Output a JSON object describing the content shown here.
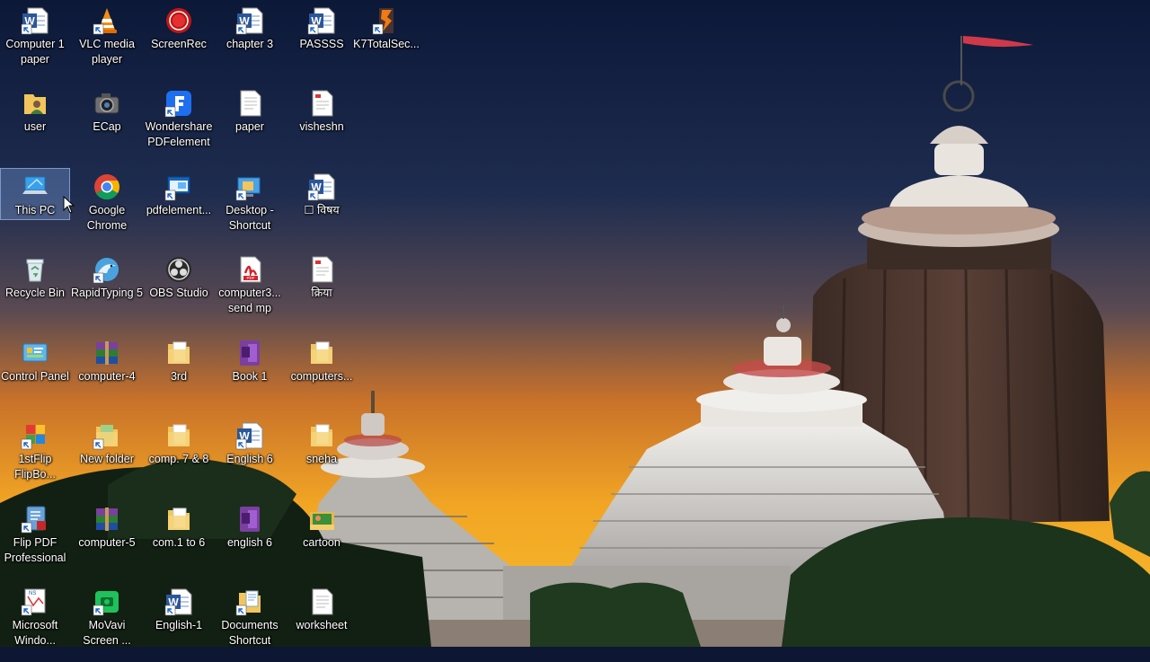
{
  "desktop": {
    "columns": [
      [
        {
          "label": "Computer 1 paper",
          "icon": "word-document-icon",
          "kind": "word"
        },
        {
          "label": "user",
          "icon": "user-folder-icon",
          "kind": "userfolder"
        },
        {
          "label": "This PC",
          "icon": "computer-icon",
          "kind": "pc",
          "selected": true
        },
        {
          "label": "Recycle Bin",
          "icon": "recycle-bin-icon",
          "kind": "bin"
        },
        {
          "label": "Control Panel",
          "icon": "control-panel-icon",
          "kind": "cpanel"
        },
        {
          "label": "1stFlip FlipBo...",
          "icon": "flipbook-icon",
          "kind": "flip"
        },
        {
          "label": "Flip PDF Professional",
          "icon": "flip-pdf-icon",
          "kind": "flippdf"
        },
        {
          "label": "Microsoft Windo...",
          "icon": "ms-app-icon",
          "kind": "msapp"
        }
      ],
      [
        {
          "label": "VLC media player",
          "icon": "vlc-cone-icon",
          "kind": "vlc"
        },
        {
          "label": "ECap",
          "icon": "camera-icon",
          "kind": "camera"
        },
        {
          "label": "Google Chrome",
          "icon": "chrome-icon",
          "kind": "chrome"
        },
        {
          "label": "RapidTyping 5",
          "icon": "dolphin-icon",
          "kind": "rapid"
        },
        {
          "label": "computer-4",
          "icon": "winrar-archive-icon",
          "kind": "rar"
        },
        {
          "label": "New folder",
          "icon": "folder-icon",
          "kind": "folder2"
        },
        {
          "label": "computer-5",
          "icon": "winrar-archive-icon",
          "kind": "rar"
        },
        {
          "label": "MoVavi Screen ...",
          "icon": "movavi-icon",
          "kind": "movavi"
        }
      ],
      [
        {
          "label": "ScreenRec",
          "icon": "record-icon",
          "kind": "rec"
        },
        {
          "label": "Wondershare PDFelement",
          "icon": "pdfelement-icon",
          "kind": "pdfel"
        },
        {
          "label": "pdfelement...",
          "icon": "shortcut-window-icon",
          "kind": "pdfel2"
        },
        {
          "label": "OBS Studio",
          "icon": "obs-icon",
          "kind": "obs"
        },
        {
          "label": "3rd",
          "icon": "folder-icon",
          "kind": "folder"
        },
        {
          "label": "comp. 7 & 8",
          "icon": "folder-icon",
          "kind": "folder"
        },
        {
          "label": "com.1 to 6",
          "icon": "folder-icon",
          "kind": "folder"
        },
        {
          "label": "English-1",
          "icon": "word-document-icon",
          "kind": "word"
        }
      ],
      [
        {
          "label": "chapter 3",
          "icon": "word-document-icon",
          "kind": "word"
        },
        {
          "label": "paper",
          "icon": "text-document-icon",
          "kind": "doc"
        },
        {
          "label": "Desktop - Shortcut",
          "icon": "desktop-shortcut-icon",
          "kind": "deskshort"
        },
        {
          "label": "computer3... send mp",
          "icon": "pdf-icon",
          "kind": "pdf"
        },
        {
          "label": "Book 1",
          "icon": "onenote-icon",
          "kind": "onenote"
        },
        {
          "label": "English 6",
          "icon": "word-document-icon",
          "kind": "word"
        },
        {
          "label": "english 6",
          "icon": "onenote-icon",
          "kind": "onenote"
        },
        {
          "label": "Documents Shortcut",
          "icon": "documents-shortcut-icon",
          "kind": "docshort"
        }
      ],
      [
        {
          "label": "PASSSS",
          "icon": "word-document-icon",
          "kind": "word"
        },
        {
          "label": "visheshn",
          "icon": "text-document-icon",
          "kind": "pdfdoc"
        },
        {
          "label": "☐ विषय",
          "icon": "word-document-icon",
          "kind": "word"
        },
        {
          "label": "क्रिया",
          "icon": "text-document-icon",
          "kind": "pdfdoc"
        },
        {
          "label": "computers...",
          "icon": "folder-icon",
          "kind": "folder"
        },
        {
          "label": "sneha",
          "icon": "folder-icon",
          "kind": "folder"
        },
        {
          "label": "cartoon",
          "icon": "image-folder-icon",
          "kind": "imgfolder"
        },
        {
          "label": "worksheet",
          "icon": "text-document-icon",
          "kind": "doc"
        }
      ],
      [
        {
          "label": "K7TotalSec...",
          "icon": "k7-shield-icon",
          "kind": "k7"
        }
      ]
    ]
  }
}
